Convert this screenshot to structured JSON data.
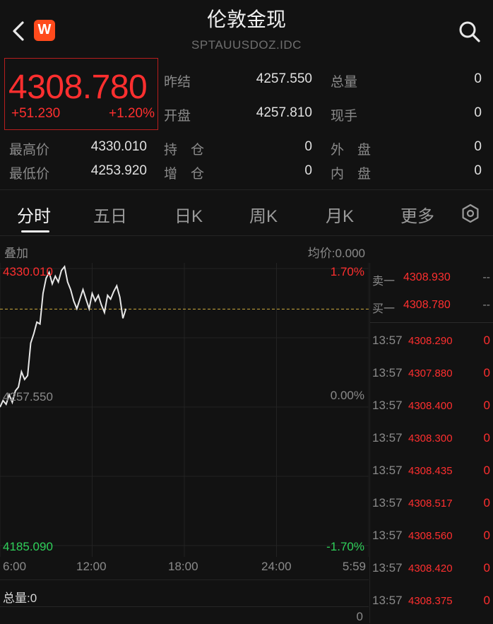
{
  "header": {
    "title": "伦敦金现",
    "code": "SPTAUUSDOZ.IDC",
    "badge": "W"
  },
  "quote": {
    "price": "4308.780",
    "change": "+51.230",
    "change_pct": "+1.20%",
    "prev_close_label": "昨结",
    "prev_close": "4257.550",
    "open_label": "开盘",
    "open": "4257.810",
    "total_vol_label": "总量",
    "total_vol": "0",
    "current_hand_label": "现手",
    "current_hand": "0",
    "high_label": "最高价",
    "high": "4330.010",
    "low_label": "最低价",
    "low": "4253.920",
    "position_label": "持　仓",
    "position": "0",
    "add_position_label": "增　仓",
    "add_position": "0",
    "outer_label": "外　盘",
    "outer": "0",
    "inner_label": "内　盘",
    "inner": "0"
  },
  "tabs": [
    "分时",
    "五日",
    "日K",
    "周K",
    "月K",
    "更多"
  ],
  "chart_header": {
    "overlay": "叠加",
    "avg": "均价:0.000"
  },
  "orderbook": {
    "sell_label": "卖一",
    "sell_price": "4308.930",
    "sell_qty": "--",
    "buy_label": "买一",
    "buy_price": "4308.780",
    "buy_qty": "--"
  },
  "ticks": [
    {
      "time": "13:57",
      "price": "4308.290",
      "vol": "0"
    },
    {
      "time": "13:57",
      "price": "4307.880",
      "vol": "0"
    },
    {
      "time": "13:57",
      "price": "4308.400",
      "vol": "0"
    },
    {
      "time": "13:57",
      "price": "4308.300",
      "vol": "0"
    },
    {
      "time": "13:57",
      "price": "4308.435",
      "vol": "0"
    },
    {
      "time": "13:57",
      "price": "4308.517",
      "vol": "0"
    },
    {
      "time": "13:57",
      "price": "4308.560",
      "vol": "0"
    },
    {
      "time": "13:57",
      "price": "4308.420",
      "vol": "0"
    },
    {
      "time": "13:57",
      "price": "4308.375",
      "vol": "0"
    }
  ],
  "volume": {
    "label": "总量:0",
    "axis_value": "0"
  },
  "colors": {
    "up": "#ff2f2f",
    "down": "#2fd05a",
    "line": "#e8e8e8",
    "prev_close": "#b89a3a"
  },
  "chart_data": {
    "type": "line",
    "x_ticks": [
      "6:00",
      "12:00",
      "18:00",
      "24:00",
      "5:59"
    ],
    "y_left_labels": [
      "4330.010",
      "4257.550",
      "4185.090"
    ],
    "y_right_labels": [
      "1.70%",
      "0.00%",
      "-1.70%"
    ],
    "ylim": [
      4185.09,
      4330.01
    ],
    "prev_close": 4257.55,
    "current": 4308.78,
    "x_hours": [
      0,
      0.2,
      0.4,
      0.6,
      0.8,
      1.0,
      1.2,
      1.4,
      1.6,
      1.8,
      2.0,
      2.2,
      2.4,
      2.6,
      2.8,
      3.0,
      3.2,
      3.4,
      3.6,
      3.8,
      4.0,
      4.2,
      4.4,
      4.6,
      4.8,
      5.0,
      5.2,
      5.4,
      5.6,
      5.8,
      6.0,
      6.2,
      6.4,
      6.6,
      6.8,
      7.0,
      7.2,
      7.4,
      7.6,
      7.8,
      8.0,
      8.2
    ],
    "values": [
      4257.5,
      4261,
      4259,
      4264,
      4260,
      4266,
      4268,
      4276,
      4272,
      4274,
      4291,
      4296,
      4302,
      4301,
      4317,
      4325,
      4328,
      4322,
      4326,
      4323,
      4329,
      4331,
      4323,
      4319,
      4313,
      4309,
      4314,
      4319,
      4314,
      4309,
      4317,
      4313,
      4316,
      4311,
      4307,
      4316,
      4314,
      4318,
      4321,
      4315,
      4304,
      4309
    ]
  }
}
